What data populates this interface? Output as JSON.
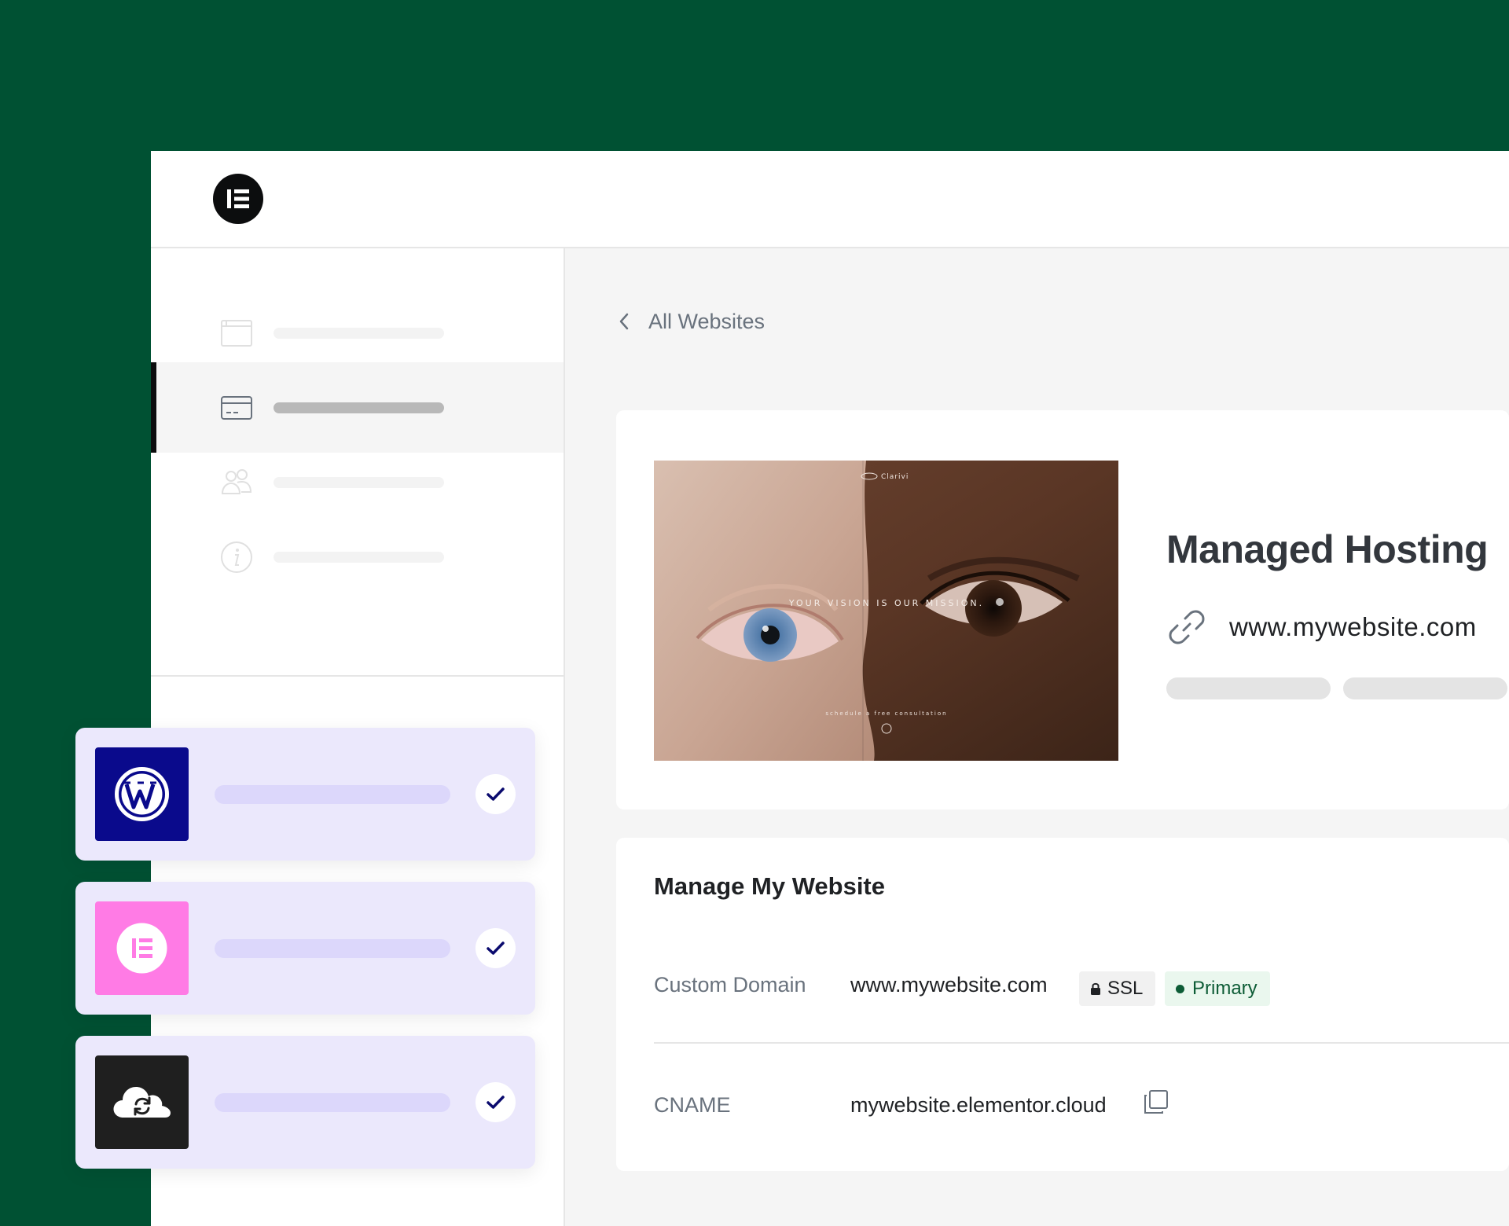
{
  "header": {
    "logo_icon": "elementor-logo-icon"
  },
  "sidebar": {
    "items": [
      {
        "icon": "browser-window-icon",
        "active": false
      },
      {
        "icon": "credit-card-icon",
        "active": true
      },
      {
        "icon": "users-icon",
        "active": false
      },
      {
        "icon": "info-icon",
        "active": false
      }
    ]
  },
  "breadcrumb": {
    "back_label": "All Websites"
  },
  "site_card": {
    "title": "Managed Hosting",
    "url": "www.mywebsite.com",
    "preview": {
      "brand": "Clarivi",
      "headline": "YOUR VISION IS OUR MISSION.",
      "cta": "schedule a free consultation"
    }
  },
  "manage": {
    "title": "Manage My Website",
    "custom_domain_label": "Custom Domain",
    "custom_domain_value": "www.mywebsite.com",
    "ssl_badge": "SSL",
    "primary_badge": "Primary",
    "cname_label": "CNAME",
    "cname_value": "mywebsite.elementor.cloud"
  },
  "float_cards": [
    {
      "icon": "wordpress-icon",
      "icon_bg": "#0a0a8c",
      "checked": true
    },
    {
      "icon": "elementor-icon",
      "icon_bg": "#ff7be5",
      "checked": true
    },
    {
      "icon": "cloud-sync-icon",
      "icon_bg": "#1f1f1f",
      "checked": true
    }
  ],
  "colors": {
    "brand_green": "#005133",
    "accent_lavender": "#ebe8fc",
    "check_navy": "#0a0a6e"
  }
}
